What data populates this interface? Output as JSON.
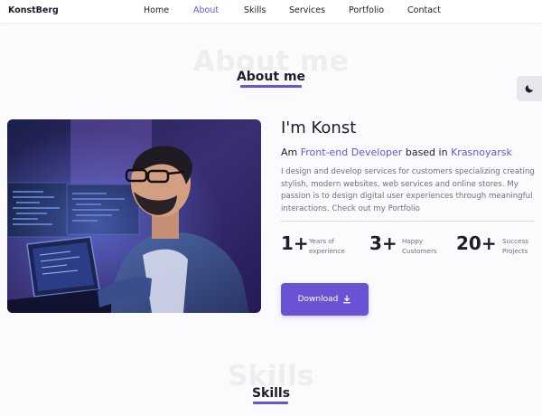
{
  "header": {
    "brand": "KonstBerg",
    "nav": [
      "Home",
      "About",
      "Skills",
      "Services",
      "Portfolio",
      "Contact"
    ],
    "active": "About"
  },
  "about": {
    "ghost_title": "About me",
    "title": "About me",
    "hello": "I'm Konst",
    "role_prefix": "Am ",
    "role": "Front-end Developer",
    "role_mid": " based in ",
    "city": "Krasnoyarsk",
    "description": "I design and develop services for customers specializing creating stylish, modern websites, web services and online stores. My passion is to design digital user experiences through meaningful interactions. Check out my Portfolio",
    "stats": [
      {
        "number": "1+",
        "label1": "Years of",
        "label2": "experience"
      },
      {
        "number": "3+",
        "label1": "Happy",
        "label2": "Customers"
      },
      {
        "number": "20+",
        "label1": "Success",
        "label2": "Projects"
      }
    ],
    "download_label": "Download",
    "download_icon": "download-icon"
  },
  "skills": {
    "ghost_title": "Skills",
    "title": "Skills"
  },
  "theme_toggle_icon": "moon-icon",
  "colors": {
    "accent": "#6a52d4",
    "text": "#1d1d2b",
    "muted": "#6f6f7e",
    "background": "#fbfbfd"
  }
}
